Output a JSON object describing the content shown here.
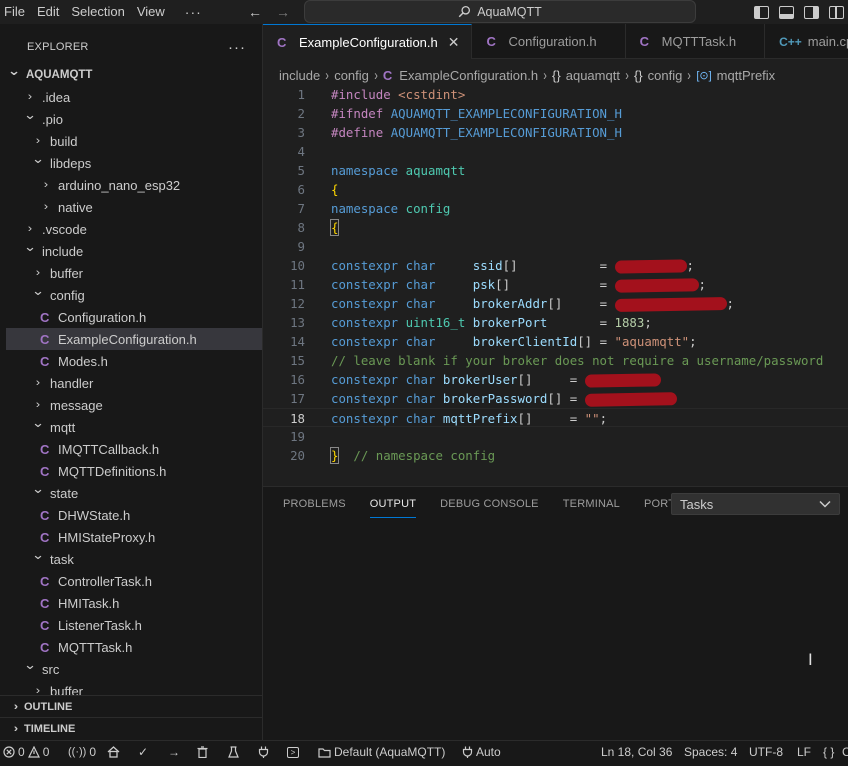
{
  "menu": [
    "File",
    "Edit",
    "Selection",
    "View"
  ],
  "menu_more": "···",
  "search": {
    "text": "AquaMQTT"
  },
  "sidebar": {
    "title": "EXPLORER",
    "more": "···",
    "tree": [
      {
        "label": "AQUAMQTT",
        "kind": "root",
        "depth": 0,
        "open": true
      },
      {
        "label": ".idea",
        "kind": "folder",
        "depth": 1,
        "open": false
      },
      {
        "label": ".pio",
        "kind": "folder",
        "depth": 1,
        "open": true
      },
      {
        "label": "build",
        "kind": "folder",
        "depth": 2,
        "open": false
      },
      {
        "label": "libdeps",
        "kind": "folder",
        "depth": 2,
        "open": true
      },
      {
        "label": "arduino_nano_esp32",
        "kind": "folder",
        "depth": 3,
        "open": false
      },
      {
        "label": "native",
        "kind": "folder",
        "depth": 3,
        "open": false
      },
      {
        "label": ".vscode",
        "kind": "folder",
        "depth": 1,
        "open": false
      },
      {
        "label": "include",
        "kind": "folder",
        "depth": 1,
        "open": true
      },
      {
        "label": "buffer",
        "kind": "folder",
        "depth": 2,
        "open": false
      },
      {
        "label": "config",
        "kind": "folder",
        "depth": 2,
        "open": true
      },
      {
        "label": "Configuration.h",
        "kind": "file",
        "depth": 3
      },
      {
        "label": "ExampleConfiguration.h",
        "kind": "file",
        "depth": 3,
        "selected": true
      },
      {
        "label": "Modes.h",
        "kind": "file",
        "depth": 3
      },
      {
        "label": "handler",
        "kind": "folder",
        "depth": 2,
        "open": false
      },
      {
        "label": "message",
        "kind": "folder",
        "depth": 2,
        "open": false
      },
      {
        "label": "mqtt",
        "kind": "folder",
        "depth": 2,
        "open": true
      },
      {
        "label": "IMQTTCallback.h",
        "kind": "file",
        "depth": 3
      },
      {
        "label": "MQTTDefinitions.h",
        "kind": "file",
        "depth": 3
      },
      {
        "label": "state",
        "kind": "folder",
        "depth": 2,
        "open": true
      },
      {
        "label": "DHWState.h",
        "kind": "file",
        "depth": 3
      },
      {
        "label": "HMIStateProxy.h",
        "kind": "file",
        "depth": 3
      },
      {
        "label": "task",
        "kind": "folder",
        "depth": 2,
        "open": true
      },
      {
        "label": "ControllerTask.h",
        "kind": "file",
        "depth": 3
      },
      {
        "label": "HMITask.h",
        "kind": "file",
        "depth": 3
      },
      {
        "label": "ListenerTask.h",
        "kind": "file",
        "depth": 3
      },
      {
        "label": "MQTTTask.h",
        "kind": "file",
        "depth": 3
      },
      {
        "label": "src",
        "kind": "folder",
        "depth": 1,
        "open": true
      },
      {
        "label": "buffer",
        "kind": "folder",
        "depth": 2,
        "open": false
      }
    ],
    "outline": "OUTLINE",
    "timeline": "TIMELINE"
  },
  "tabs": [
    {
      "label": "ExampleConfiguration.h",
      "icon": "C",
      "active": true,
      "close": "✕"
    },
    {
      "label": "Configuration.h",
      "icon": "C"
    },
    {
      "label": "MQTTTask.h",
      "icon": "C"
    },
    {
      "label": "main.cpp",
      "icon": "C++"
    }
  ],
  "breadcrumb": [
    "include",
    "config",
    "ExampleConfiguration.h",
    "aquamqtt",
    "config",
    "mqttPrefix"
  ],
  "code_lines": [
    {
      "n": "1",
      "tokens": [
        [
          "pp",
          "#include"
        ],
        [
          "",
          " "
        ],
        [
          "str",
          "<cstdint>"
        ]
      ]
    },
    {
      "n": "2",
      "tokens": [
        [
          "pp",
          "#ifndef"
        ],
        [
          "",
          " "
        ],
        [
          "mac",
          "AQUAMQTT_EXAMPLECONFIGURATION_H"
        ]
      ]
    },
    {
      "n": "3",
      "tokens": [
        [
          "pp",
          "#define"
        ],
        [
          "",
          " "
        ],
        [
          "mac",
          "AQUAMQTT_EXAMPLECONFIGURATION_H"
        ]
      ]
    },
    {
      "n": "4",
      "tokens": []
    },
    {
      "n": "5",
      "tokens": [
        [
          "kw",
          "namespace"
        ],
        [
          "",
          " "
        ],
        [
          "ty",
          "aquamqtt"
        ]
      ]
    },
    {
      "n": "6",
      "tokens": [
        [
          "brace",
          "{"
        ]
      ]
    },
    {
      "n": "7",
      "tokens": [
        [
          "kw",
          "namespace"
        ],
        [
          "",
          " "
        ],
        [
          "ty",
          "config"
        ]
      ]
    },
    {
      "n": "8",
      "tokens": [
        [
          "brace-box",
          "{"
        ]
      ]
    },
    {
      "n": "9",
      "tokens": []
    },
    {
      "n": "10",
      "tokens": [
        [
          "kw",
          "constexpr"
        ],
        [
          "",
          " "
        ],
        [
          "kw",
          "char"
        ],
        [
          "",
          "     "
        ],
        [
          "id",
          "ssid"
        ],
        [
          "",
          "[]"
        ],
        [
          "",
          "           = "
        ],
        [
          "redact",
          "72"
        ],
        [
          "",
          ";"
        ]
      ]
    },
    {
      "n": "11",
      "tokens": [
        [
          "kw",
          "constexpr"
        ],
        [
          "",
          " "
        ],
        [
          "kw",
          "char"
        ],
        [
          "",
          "     "
        ],
        [
          "id",
          "psk"
        ],
        [
          "",
          "[]"
        ],
        [
          "",
          "            = "
        ],
        [
          "redact",
          "84"
        ],
        [
          "",
          ";"
        ]
      ]
    },
    {
      "n": "12",
      "tokens": [
        [
          "kw",
          "constexpr"
        ],
        [
          "",
          " "
        ],
        [
          "kw",
          "char"
        ],
        [
          "",
          "     "
        ],
        [
          "id",
          "brokerAddr"
        ],
        [
          "",
          "[]"
        ],
        [
          "",
          "     = "
        ],
        [
          "redact",
          "112"
        ],
        [
          "",
          ";"
        ]
      ]
    },
    {
      "n": "13",
      "tokens": [
        [
          "kw",
          "constexpr"
        ],
        [
          "",
          " "
        ],
        [
          "ty",
          "uint16_t"
        ],
        [
          "",
          " "
        ],
        [
          "id",
          "brokerPort"
        ],
        [
          "",
          "       = "
        ],
        [
          "num",
          "1883"
        ],
        [
          "",
          ";"
        ]
      ]
    },
    {
      "n": "14",
      "tokens": [
        [
          "kw",
          "constexpr"
        ],
        [
          "",
          " "
        ],
        [
          "kw",
          "char"
        ],
        [
          "",
          "     "
        ],
        [
          "id",
          "brokerClientId"
        ],
        [
          "",
          "[] = "
        ],
        [
          "str",
          "\"aquamqtt\""
        ],
        [
          "",
          ";"
        ]
      ]
    },
    {
      "n": "15",
      "tokens": [
        [
          "cm",
          "// leave blank if your broker does not require a username/password"
        ]
      ]
    },
    {
      "n": "16",
      "tokens": [
        [
          "kw",
          "constexpr"
        ],
        [
          "",
          " "
        ],
        [
          "kw",
          "char"
        ],
        [
          "",
          " "
        ],
        [
          "id",
          "brokerUser"
        ],
        [
          "",
          "[]"
        ],
        [
          "",
          "     = "
        ],
        [
          "redact",
          "76"
        ]
      ]
    },
    {
      "n": "17",
      "tokens": [
        [
          "kw",
          "constexpr"
        ],
        [
          "",
          " "
        ],
        [
          "kw",
          "char"
        ],
        [
          "",
          " "
        ],
        [
          "id",
          "brokerPassword"
        ],
        [
          "",
          "[] = "
        ],
        [
          "redact",
          "92"
        ]
      ]
    },
    {
      "n": "18",
      "tokens": [
        [
          "kw",
          "constexpr"
        ],
        [
          "",
          " "
        ],
        [
          "kw",
          "char"
        ],
        [
          "",
          " "
        ],
        [
          "id",
          "mqttPrefix"
        ],
        [
          "",
          "[]"
        ],
        [
          "",
          "     = "
        ],
        [
          "str",
          "\"\""
        ],
        [
          "",
          ";"
        ]
      ],
      "current": true
    },
    {
      "n": "19",
      "tokens": []
    },
    {
      "n": "20",
      "tokens": [
        [
          "brace-box",
          "}"
        ],
        [
          "",
          "  "
        ],
        [
          "cm",
          "// namespace config"
        ]
      ]
    }
  ],
  "panel": {
    "tabs": [
      "PROBLEMS",
      "OUTPUT",
      "DEBUG CONSOLE",
      "TERMINAL",
      "PORTS"
    ],
    "active_tab": "OUTPUT",
    "select_value": "Tasks"
  },
  "status": {
    "errors": "0",
    "warnings": "0",
    "ports": "0",
    "env": "Default (AquaMQTT)",
    "port": "Auto",
    "position": "Ln 18, Col 36",
    "spaces": "Spaces: 4",
    "encoding": "UTF-8",
    "eol": "LF",
    "lang": "{ }"
  },
  "colors": {
    "accent": "#0078d4",
    "c_icon": "#a074c4",
    "redaction": "#a3111c"
  }
}
